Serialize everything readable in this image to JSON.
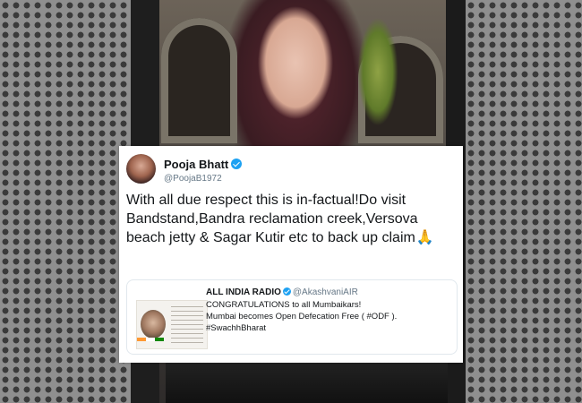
{
  "tweet": {
    "display_name": "Pooja Bhatt",
    "handle": "@PoojaB1972",
    "text": "With all due respect this is in-factual!Do visit Bandstand,Bandra reclamation creek,Versova beach jetty & Sagar Kutir etc to back up claim",
    "emoji": "🙏",
    "verified_icon": "verified-badge-icon"
  },
  "quoted_tweet": {
    "display_name": "ALL INDIA RADIO",
    "handle": "@AkashvaniAIR",
    "lines": [
      "CONGRATULATIONS to all Mumbaikars!",
      "Mumbai becomes Open Defecation Free ( #ODF ).",
      "#SwachhBharat"
    ]
  },
  "colors": {
    "verified_blue": "#1da1f2",
    "text_primary": "#14171a",
    "text_secondary": "#657786"
  }
}
